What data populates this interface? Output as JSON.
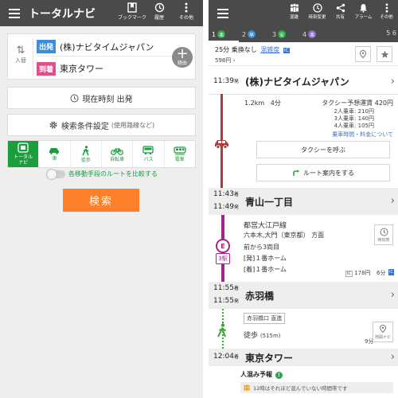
{
  "left": {
    "title": "トータルナビ",
    "toolbar": [
      {
        "label": "ブックマーク",
        "icon": "bookmark-icon"
      },
      {
        "label": "履歴",
        "icon": "history-icon"
      },
      {
        "label": "その他",
        "icon": "more-vert-icon"
      }
    ],
    "route": {
      "swap_label": "入替",
      "departure_tag": "出発",
      "departure": "(株)ナビタイムジャパン",
      "arrival_tag": "到着",
      "arrival": "東京タワー",
      "via_label": "経由"
    },
    "now_button": "現在時刻 出発",
    "conditions_button": "検索条件設定",
    "conditions_sub": "(使用路線など)",
    "modes": [
      {
        "label": "トータル\nナビ",
        "icon": "total-navi-icon",
        "selected": true
      },
      {
        "label": "車",
        "icon": "car-icon",
        "selected": false
      },
      {
        "label": "徒歩",
        "icon": "walk-icon",
        "selected": false
      },
      {
        "label": "自転車",
        "icon": "bicycle-icon",
        "selected": false
      },
      {
        "label": "バス",
        "icon": "bus-icon",
        "selected": false
      },
      {
        "label": "電車",
        "icon": "train-icon",
        "selected": false
      }
    ],
    "compare_label": "各移動手段のルートを比較する",
    "search_button": "検索",
    "colors": {
      "accent_green": "#1b9e3e",
      "search_orange": "#ff7f2a",
      "header": "#4a4a4a"
    }
  },
  "right": {
    "toolbar": [
      {
        "label": "混雑",
        "icon": "crowd-icon"
      },
      {
        "label": "時刻変更",
        "icon": "clock-icon"
      },
      {
        "label": "共有",
        "icon": "share-icon"
      },
      {
        "label": "アラーム",
        "icon": "bell-icon"
      },
      {
        "label": "その他",
        "icon": "more-vert-icon"
      }
    ],
    "tabs": [
      {
        "num": "1",
        "badge": "楽",
        "badge_color": "#2aa84a"
      },
      {
        "num": "2",
        "badge": "早",
        "badge_color": "#3a8fd8"
      },
      {
        "num": "3",
        "badge": "安",
        "badge_color": "#2aa84a"
      },
      {
        "num": "4",
        "badge": "楽",
        "badge_color": "#8a6bd0"
      }
    ],
    "tab_more": "5   6",
    "summary": {
      "duration": "25分 乗換なし",
      "crowd": "混雑度",
      "fare": "598円"
    },
    "stops": [
      {
        "time": "11:39",
        "suffix": "発",
        "name": "(株)ナビタイムジャパン"
      },
      {
        "time_arr": "11:43",
        "time_dep": "11:49",
        "name": "青山一丁目"
      },
      {
        "time_arr": "11:55",
        "time_dep": "11:55",
        "name": "赤羽橋"
      },
      {
        "time": "12:04",
        "suffix": "着",
        "name": "東京タワー"
      }
    ],
    "taxi": {
      "distance": "1.2km",
      "duration": "4分",
      "fare_label": "タクシー予想運賃 420円",
      "p2": "2人乗車: 210円",
      "p3": "3人乗車: 140円",
      "p4": "4人乗車: 105円",
      "fare_link": "乗車時間・料金について",
      "call_button": "タクシーを呼ぶ",
      "guide_button": "ルート案内をする"
    },
    "train": {
      "line": "都営大江戸線",
      "direction": "六本木,大門（東京都） 方面",
      "car": "前から3両目",
      "dep_platform": "[発]１番ホーム",
      "arr_platform": "[着]１番ホーム",
      "stations": "3駅",
      "line_badge": "E",
      "timetable": "時刻表",
      "ic_fare": "178円",
      "ride_time": "6分"
    },
    "walk": {
      "exit": "赤羽橋口 直進",
      "label": "徒歩",
      "distance": "(515m)",
      "duration": "9分",
      "map_button": "地図ナビ"
    },
    "crowd_forecast": {
      "title": "人混み予報",
      "text": "12時はそれほど混んでいない時間帯です"
    },
    "colors": {
      "taxi_line": "#b03838",
      "train_line": "#a3238f",
      "walk_line": "#3aa83a",
      "link": "#3a73c8"
    }
  }
}
